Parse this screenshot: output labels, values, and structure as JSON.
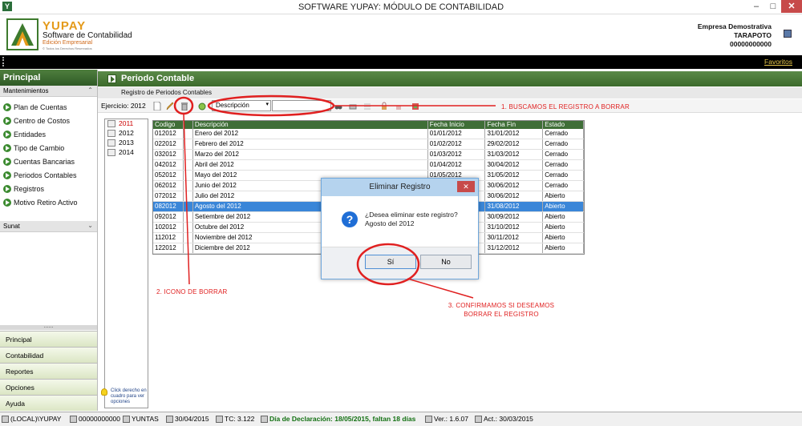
{
  "window": {
    "title": "SOFTWARE YUPAY: MÓDULO DE CONTABILIDAD",
    "icon": "Y",
    "min": "–",
    "max": "□",
    "close": "✕"
  },
  "logo": {
    "brand": "YUPAY",
    "subtitle": "Software de Contabilidad",
    "edition": "Edición Empresarial",
    "rights": "© Todos los Derechos Reservados"
  },
  "company": {
    "name": "Empresa Demostrativa",
    "city": "TARAPOTO",
    "ruc": "00000000000"
  },
  "topbar": {
    "favorites": "Favoritos"
  },
  "sidebar": {
    "title": "Principal",
    "section_mantenimientos": "Mantenimientos",
    "collapse_chev": "⌃",
    "items": [
      {
        "label": "Plan de Cuentas"
      },
      {
        "label": "Centro de Costos"
      },
      {
        "label": "Entidades"
      },
      {
        "label": "Tipo de Cambio"
      },
      {
        "label": "Cuentas Bancarias"
      },
      {
        "label": "Periodos Contables"
      },
      {
        "label": "Registros"
      },
      {
        "label": "Motivo Retiro Activo"
      }
    ],
    "section_sunat": "Sunat",
    "expand_chev": "⌄",
    "dots": "......",
    "nav_buttons": [
      "Principal",
      "Contabilidad",
      "Reportes",
      "Opciones",
      "Ayuda"
    ]
  },
  "content": {
    "title": "Periodo Contable",
    "tab": "Registro de Periodos Contables",
    "ejercicio": "Ejercicio: 2012",
    "search_field": "Descripción",
    "dropdown_arrow": "▾"
  },
  "years": [
    "2011",
    "2012",
    "2013",
    "2014"
  ],
  "selected_year_index": 0,
  "hint": "Click derecho en cuadro para ver opciones",
  "grid": {
    "columns": [
      "Codigo",
      "",
      "Descripción",
      "Fecha Inicio",
      "Fecha Fin",
      "Estado"
    ],
    "selected_row_index": 7,
    "rows": [
      [
        "012012",
        "",
        "Enero del 2012",
        "01/01/2012",
        "31/01/2012",
        "Cerrado"
      ],
      [
        "022012",
        "",
        "Febrero del 2012",
        "01/02/2012",
        "29/02/2012",
        "Cerrado"
      ],
      [
        "032012",
        "",
        "Marzo del 2012",
        "01/03/2012",
        "31/03/2012",
        "Cerrado"
      ],
      [
        "042012",
        "",
        "Abril del 2012",
        "01/04/2012",
        "30/04/2012",
        "Cerrado"
      ],
      [
        "052012",
        "",
        "Mayo del 2012",
        "01/05/2012",
        "31/05/2012",
        "Cerrado"
      ],
      [
        "062012",
        "",
        "Junio del 2012",
        "01/06/2012",
        "30/06/2012",
        "Cerrado"
      ],
      [
        "072012",
        "",
        "Julio del 2012",
        "01/07/2012",
        "30/06/2012",
        "Abierto"
      ],
      [
        "082012",
        "",
        "Agosto del 2012",
        "01/08/2012",
        "31/08/2012",
        "Abierto"
      ],
      [
        "092012",
        "",
        "Setiembre del 2012",
        "01/09/2012",
        "30/09/2012",
        "Abierto"
      ],
      [
        "102012",
        "",
        "Octubre del 2012",
        "01/10/2012",
        "31/10/2012",
        "Abierto"
      ],
      [
        "112012",
        "",
        "Noviembre del 2012",
        "01/11/2012",
        "30/11/2012",
        "Abierto"
      ],
      [
        "122012",
        "",
        "Diciembre del 2012",
        "01/12/2012",
        "31/12/2012",
        "Abierto"
      ]
    ]
  },
  "dialog": {
    "title": "Eliminar Registro",
    "close": "✕",
    "icon": "?",
    "message_line1": "¿Desea eliminar este registro?",
    "message_line2": "Agosto del 2012",
    "yes": "Sí",
    "no": "No"
  },
  "annotations": {
    "step1": "1.  BUSCAMOS EL REGISTRO A BORRAR",
    "step2": "2.  ICONO DE BORRAR",
    "step3": "3.  CONFIRMAMOS SI DESEAMOS BORRAR EL REGISTRO",
    "color": "#e02020"
  },
  "statusbar": {
    "server": "(LOCAL)\\YUPAY",
    "ruc": "00000000000",
    "user": "YUNTAS",
    "date": "30/04/2015",
    "tc": "TC: 3.122",
    "declaracion": "Día de Declaración: 18/05/2015, faltan 18 días",
    "version": "Ver.: 1.6.07",
    "act": "Act.: 30/03/2015"
  },
  "colors": {
    "accent_green": "#3f6e37",
    "selection_blue": "#3a86d8",
    "brand_orange": "#e49a1a"
  }
}
